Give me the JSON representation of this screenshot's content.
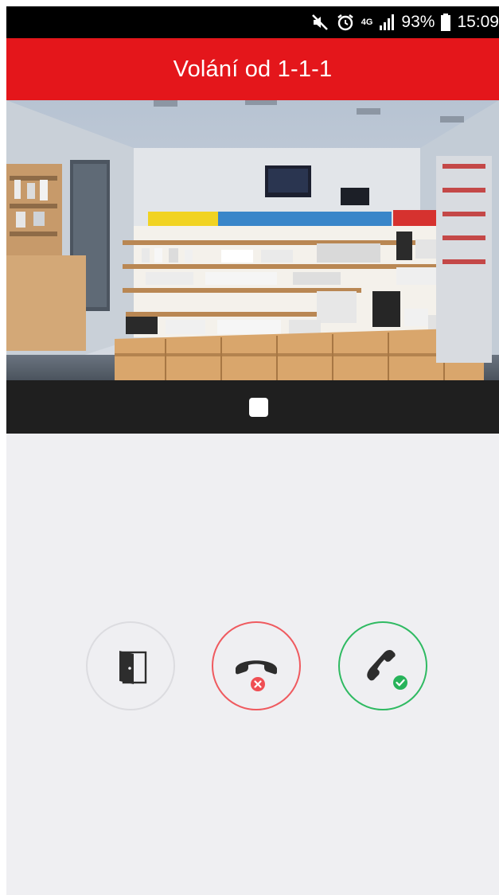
{
  "status_bar": {
    "network": "4G",
    "battery": "93%",
    "time": "15:09"
  },
  "header": {
    "title": "Volání od 1-1-1",
    "color": "#e4161b"
  },
  "video": {
    "content": "live camera feed"
  },
  "actions": {
    "open_door": {
      "icon": "door-open-icon"
    },
    "decline": {
      "icon": "phone-hangup-icon",
      "color": "#ef5a5f"
    },
    "accept": {
      "icon": "phone-accept-icon",
      "color": "#2fba62"
    }
  }
}
